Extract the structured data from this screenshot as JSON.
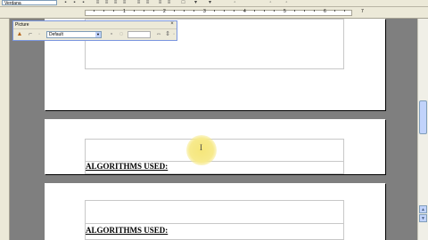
{
  "toolbar": {
    "font_name": "Verdana",
    "buttons": [
      "bold",
      "italic",
      "underline",
      "align-left",
      "align-center",
      "align-right",
      "justify",
      "numbering",
      "bullets",
      "indent-decrease",
      "indent-increase",
      "border",
      "highlight",
      "font-color"
    ]
  },
  "ruler": {
    "numbers": [
      "1",
      "2",
      "3",
      "4",
      "5",
      "6",
      "7"
    ]
  },
  "picture_toolbar": {
    "title": "Picture",
    "close_glyph": "×",
    "mode_value": "Default",
    "icons": [
      "filter-icon",
      "crop-icon",
      "color-mode-icon",
      "flip-horizontal-icon",
      "flip-vertical-icon",
      "properties-icon"
    ]
  },
  "document": {
    "heading_1": "ALGORITHMS USED:",
    "heading_2": "ALGORITHMS USED:"
  },
  "scrollbar": {
    "up_glyph": "▲",
    "down_glyph": "▼"
  }
}
